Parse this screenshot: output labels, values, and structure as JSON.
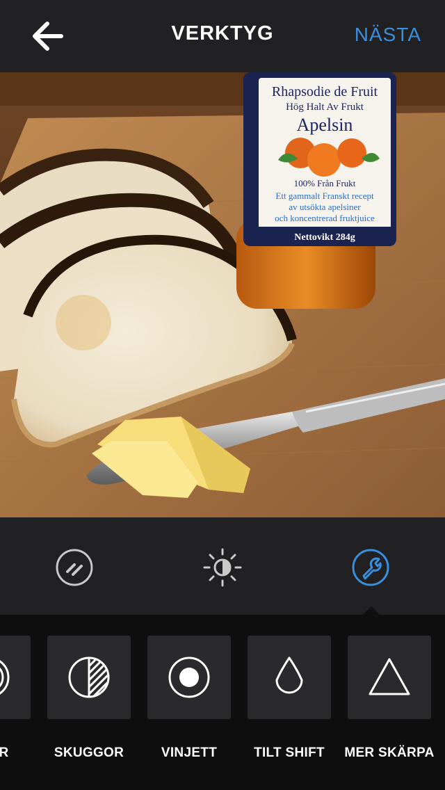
{
  "header": {
    "title": "VERKTYG",
    "next_label": "NÄSTA",
    "accent_color": "#3a8fdc"
  },
  "photo": {
    "subject": "toast-with-butter-and-marmalade",
    "jar_label": {
      "brand": "Rhapsodie de Fruit",
      "line1": "Hög Halt Av Frukt",
      "flavor": "Apelsin",
      "fruit_text": "100% Från Frukt",
      "desc1": "Ett gammalt Franskt recept",
      "desc2": "av utsökta apelsiner",
      "desc3": "och koncentrerad fruktjuice",
      "weight": "Nettovikt 284g"
    }
  },
  "modes": [
    {
      "name": "lux",
      "icon": "lux-icon",
      "active": false
    },
    {
      "name": "adjust",
      "icon": "brightness-icon",
      "active": false
    },
    {
      "name": "tools",
      "icon": "wrench-icon",
      "active": true
    }
  ],
  "tools": [
    {
      "label": "GRAR",
      "icon": "highlights-icon"
    },
    {
      "label": "SKUGGOR",
      "icon": "shadows-icon"
    },
    {
      "label": "VINJETT",
      "icon": "vignette-icon"
    },
    {
      "label": "TILT SHIFT",
      "icon": "drop-icon"
    },
    {
      "label": "MER SKÄRPA",
      "icon": "triangle-icon"
    }
  ]
}
